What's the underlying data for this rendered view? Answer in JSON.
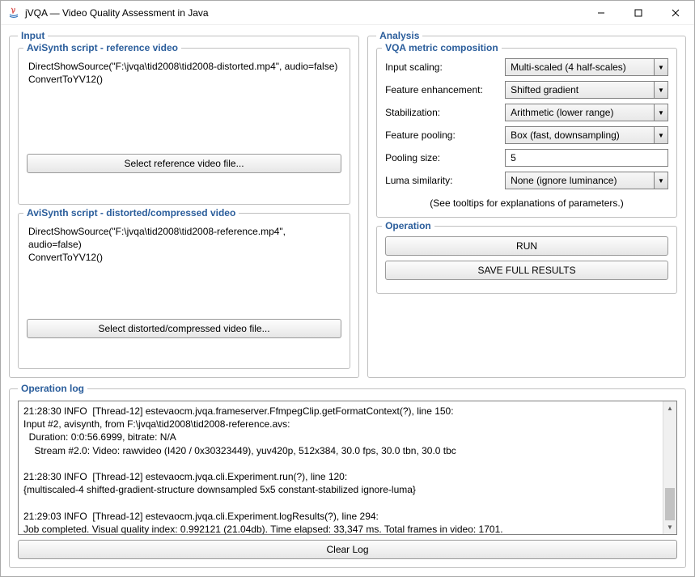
{
  "window": {
    "title": "jVQA — Video Quality Assessment in Java"
  },
  "input": {
    "legend": "Input",
    "ref": {
      "legend": "AviSynth script - reference video",
      "script": "DirectShowSource(\"F:\\jvqa\\tid2008\\tid2008-distorted.mp4\", audio=false)\nConvertToYV12()",
      "button": "Select reference video file..."
    },
    "dist": {
      "legend": "AviSynth script - distorted/compressed video",
      "script": "DirectShowSource(\"F:\\jvqa\\tid2008\\tid2008-reference.mp4\", audio=false)\nConvertToYV12()",
      "button": "Select distorted/compressed video file..."
    }
  },
  "analysis": {
    "legend": "Analysis",
    "metric": {
      "legend": "VQA metric composition",
      "input_scaling_label": "Input scaling:",
      "input_scaling_value": "Multi-scaled (4 half-scales)",
      "feature_enh_label": "Feature enhancement:",
      "feature_enh_value": "Shifted gradient",
      "stabilization_label": "Stabilization:",
      "stabilization_value": "Arithmetic (lower range)",
      "feature_pool_label": "Feature pooling:",
      "feature_pool_value": "Box (fast, downsampling)",
      "pooling_size_label": "Pooling size:",
      "pooling_size_value": "5",
      "luma_label": "Luma similarity:",
      "luma_value": "None (ignore luminance)",
      "tooltip_note": "(See tooltips for explanations of parameters.)"
    },
    "operation": {
      "legend": "Operation",
      "run": "RUN",
      "save": "SAVE FULL RESULTS"
    }
  },
  "log": {
    "legend": "Operation log",
    "text": "21:28:30 INFO  [Thread-12] estevaocm.jvqa.frameserver.FfmpegClip.getFormatContext(?), line 150:\nInput #2, avisynth, from F:\\jvqa\\tid2008\\tid2008-reference.avs:\n  Duration: 0:0:56.6999, bitrate: N/A\n    Stream #2.0: Video: rawvideo (I420 / 0x30323449), yuv420p, 512x384, 30.0 fps, 30.0 tbn, 30.0 tbc\n\n21:28:30 INFO  [Thread-12] estevaocm.jvqa.cli.Experiment.run(?), line 120:\n{multiscaled-4 shifted-gradient-structure downsampled 5x5 constant-stabilized ignore-luma}\n\n21:29:03 INFO  [Thread-12] estevaocm.jvqa.cli.Experiment.logResults(?), line 294:\nJob completed. Visual quality index: 0.992121 (21.04db). Time elapsed: 33,347 ms. Total frames in video: 1701.\n",
    "clear": "Clear Log"
  }
}
